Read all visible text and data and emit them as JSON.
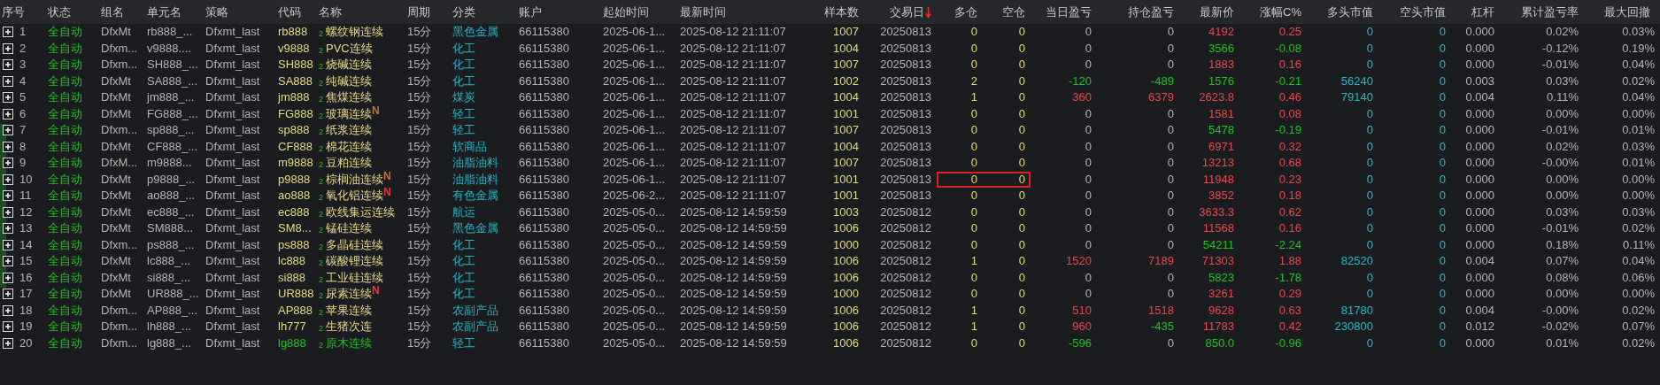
{
  "columns": [
    {
      "label": "序号",
      "sorted": false
    },
    {
      "label": "状态",
      "sorted": false
    },
    {
      "label": "组名",
      "sorted": false
    },
    {
      "label": "单元名",
      "sorted": false
    },
    {
      "label": "策略",
      "sorted": false
    },
    {
      "label": "代码",
      "sorted": false
    },
    {
      "label": "名称",
      "sorted": false
    },
    {
      "label": "周期",
      "sorted": false
    },
    {
      "label": "分类",
      "sorted": false
    },
    {
      "label": "账户",
      "sorted": false
    },
    {
      "label": "起始时间",
      "sorted": false
    },
    {
      "label": "最新时间",
      "sorted": false
    },
    {
      "label": "样本数",
      "sorted": false
    },
    {
      "label": "交易日",
      "sorted": true
    },
    {
      "label": "多仓",
      "sorted": false
    },
    {
      "label": "空仓",
      "sorted": false
    },
    {
      "label": "当日盈亏",
      "sorted": false
    },
    {
      "label": "持仓盈亏",
      "sorted": false
    },
    {
      "label": "最新价",
      "sorted": false
    },
    {
      "label": "涨幅C%",
      "sorted": false
    },
    {
      "label": "多头市值",
      "sorted": false
    },
    {
      "label": "空头市值",
      "sorted": false
    },
    {
      "label": "杠杆",
      "sorted": false
    },
    {
      "label": "累计盈亏率",
      "sorted": false
    },
    {
      "label": "最大回撤",
      "sorted": false
    }
  ],
  "rows": [
    {
      "expanded": false,
      "seq": "1",
      "status": "全自动",
      "group": "DfxMt",
      "unit": "rb888_...",
      "strategy": "Dfxmt_last",
      "code": "rb888",
      "highlighted": false,
      "tag": "2",
      "name": "螺纹钢连续",
      "period": "15分",
      "category": "黑色金属",
      "account": "66115380",
      "start": "2025-06-1...",
      "latest": "2025-08-12 21:11:07",
      "samples": "1007",
      "trade_day": "20250813",
      "long": "0",
      "short": "0",
      "boxed": false,
      "day_pnl": {
        "text": "0",
        "color": "#b4b4b4"
      },
      "pos_pnl": {
        "text": "0",
        "color": "#b4b4b4"
      },
      "price": {
        "text": "4192",
        "color": "#e5484d"
      },
      "change": {
        "text": "0.25",
        "color": "#e5484d"
      },
      "long_value": "0",
      "short_value": "0",
      "leverage": "0.000",
      "cum_rate": "0.02%",
      "max_dd": "0.03%"
    },
    {
      "expanded": false,
      "seq": "2",
      "status": "全自动",
      "group": "Dfxm...",
      "unit": "v9888....",
      "strategy": "Dfxmt_last",
      "code": "v9888",
      "highlighted": false,
      "tag": "2",
      "name": "PVC连续",
      "period": "15分",
      "category": "化工",
      "account": "66115380",
      "start": "2025-06-1...",
      "latest": "2025-08-12 21:11:07",
      "samples": "1004",
      "trade_day": "20250813",
      "long": "0",
      "short": "0",
      "boxed": false,
      "day_pnl": {
        "text": "0",
        "color": "#b4b4b4"
      },
      "pos_pnl": {
        "text": "0",
        "color": "#b4b4b4"
      },
      "price": {
        "text": "3566",
        "color": "#1fc21f"
      },
      "change": {
        "text": "-0.08",
        "color": "#1fc21f"
      },
      "long_value": "0",
      "short_value": "0",
      "leverage": "0.000",
      "cum_rate": "-0.12%",
      "max_dd": "0.19%"
    },
    {
      "expanded": false,
      "seq": "3",
      "status": "全自动",
      "group": "Dfxm...",
      "unit": "SH888_...",
      "strategy": "Dfxmt_last",
      "code": "SH888",
      "highlighted": false,
      "tag": "2",
      "name": "烧碱连续",
      "period": "15分",
      "category": "化工",
      "account": "66115380",
      "start": "2025-06-1...",
      "latest": "2025-08-12 21:11:07",
      "samples": "1007",
      "trade_day": "20250813",
      "long": "0",
      "short": "0",
      "boxed": false,
      "day_pnl": {
        "text": "0",
        "color": "#b4b4b4"
      },
      "pos_pnl": {
        "text": "0",
        "color": "#b4b4b4"
      },
      "price": {
        "text": "1883",
        "color": "#e5484d"
      },
      "change": {
        "text": "0.16",
        "color": "#e5484d"
      },
      "long_value": "0",
      "short_value": "0",
      "leverage": "0.000",
      "cum_rate": "-0.01%",
      "max_dd": "0.04%"
    },
    {
      "expanded": false,
      "seq": "4",
      "status": "全自动",
      "group": "DfxMt",
      "unit": "SA888_...",
      "strategy": "Dfxmt_last",
      "code": "SA888",
      "highlighted": false,
      "tag": "2",
      "name": "纯碱连续",
      "period": "15分",
      "category": "化工",
      "account": "66115380",
      "start": "2025-06-1...",
      "latest": "2025-08-12 21:11:07",
      "samples": "1002",
      "trade_day": "20250813",
      "long": "2",
      "short": "0",
      "boxed": false,
      "day_pnl": {
        "text": "-120",
        "color": "#1fc21f"
      },
      "pos_pnl": {
        "text": "-489",
        "color": "#1fc21f"
      },
      "price": {
        "text": "1576",
        "color": "#1fc21f"
      },
      "change": {
        "text": "-0.21",
        "color": "#1fc21f"
      },
      "long_value": "56240",
      "short_value": "0",
      "leverage": "0.003",
      "cum_rate": "0.03%",
      "max_dd": "0.02%"
    },
    {
      "expanded": false,
      "seq": "5",
      "status": "全自动",
      "group": "DfxMt",
      "unit": "jm888_...",
      "strategy": "Dfxmt_last",
      "code": "jm888",
      "highlighted": false,
      "tag": "2",
      "name": "焦煤连续",
      "period": "15分",
      "category": "煤炭",
      "account": "66115380",
      "start": "2025-06-1...",
      "latest": "2025-08-12 21:11:07",
      "samples": "1004",
      "trade_day": "20250813",
      "long": "1",
      "short": "0",
      "boxed": false,
      "day_pnl": {
        "text": "360",
        "color": "#e5484d"
      },
      "pos_pnl": {
        "text": "6379",
        "color": "#e5484d"
      },
      "price": {
        "text": "2623.8",
        "color": "#e5484d"
      },
      "change": {
        "text": "0.46",
        "color": "#e5484d"
      },
      "long_value": "79140",
      "short_value": "0",
      "leverage": "0.004",
      "cum_rate": "0.11%",
      "max_dd": "0.04%"
    },
    {
      "expanded": false,
      "seq": "6",
      "status": "全自动",
      "group": "DfxMt",
      "unit": "FG888_...",
      "strategy": "Dfxmt_last",
      "code": "FG888",
      "highlighted": false,
      "tag": "2",
      "name": "玻璃连续",
      "flag": {
        "text": "N",
        "color": "#c8703c"
      },
      "period": "15分",
      "category": "轻工",
      "account": "66115380",
      "start": "2025-06-1...",
      "latest": "2025-08-12 21:11:07",
      "samples": "1001",
      "trade_day": "20250813",
      "long": "0",
      "short": "0",
      "boxed": false,
      "day_pnl": {
        "text": "0",
        "color": "#b4b4b4"
      },
      "pos_pnl": {
        "text": "0",
        "color": "#b4b4b4"
      },
      "price": {
        "text": "1581",
        "color": "#e5484d"
      },
      "change": {
        "text": "0.08",
        "color": "#e5484d"
      },
      "long_value": "0",
      "short_value": "0",
      "leverage": "0.000",
      "cum_rate": "0.00%",
      "max_dd": "0.00%"
    },
    {
      "expanded": false,
      "seq": "7",
      "status": "全自动",
      "group": "Dfxm...",
      "unit": "sp888_...",
      "strategy": "Dfxmt_last",
      "code": "sp888",
      "highlighted": false,
      "tag": "2",
      "name": "纸浆连续",
      "period": "15分",
      "category": "轻工",
      "account": "66115380",
      "start": "2025-06-1...",
      "latest": "2025-08-12 21:11:07",
      "samples": "1007",
      "trade_day": "20250813",
      "long": "0",
      "short": "0",
      "boxed": false,
      "day_pnl": {
        "text": "0",
        "color": "#b4b4b4"
      },
      "pos_pnl": {
        "text": "0",
        "color": "#b4b4b4"
      },
      "price": {
        "text": "5478",
        "color": "#1fc21f"
      },
      "change": {
        "text": "-0.19",
        "color": "#1fc21f"
      },
      "long_value": "0",
      "short_value": "0",
      "leverage": "0.000",
      "cum_rate": "-0.01%",
      "max_dd": "0.01%"
    },
    {
      "expanded": false,
      "seq": "8",
      "status": "全自动",
      "group": "DfxMt",
      "unit": "CF888_...",
      "strategy": "Dfxmt_last",
      "code": "CF888",
      "highlighted": false,
      "tag": "2",
      "name": "棉花连续",
      "period": "15分",
      "category": "软商品",
      "account": "66115380",
      "start": "2025-06-1...",
      "latest": "2025-08-12 21:11:07",
      "samples": "1004",
      "trade_day": "20250813",
      "long": "0",
      "short": "0",
      "boxed": false,
      "day_pnl": {
        "text": "0",
        "color": "#b4b4b4"
      },
      "pos_pnl": {
        "text": "0",
        "color": "#b4b4b4"
      },
      "price": {
        "text": "6971",
        "color": "#e5484d"
      },
      "change": {
        "text": "0.32",
        "color": "#e5484d"
      },
      "long_value": "0",
      "short_value": "0",
      "leverage": "0.000",
      "cum_rate": "0.02%",
      "max_dd": "0.03%"
    },
    {
      "expanded": false,
      "seq": "9",
      "status": "全自动",
      "group": "DfxM...",
      "unit": "m9888...",
      "strategy": "Dfxmt_last",
      "code": "m9888",
      "highlighted": false,
      "tag": "2",
      "name": "豆粕连续",
      "period": "15分",
      "category": "油脂油料",
      "account": "66115380",
      "start": "2025-06-1...",
      "latest": "2025-08-12 21:11:07",
      "samples": "1007",
      "trade_day": "20250813",
      "long": "0",
      "short": "0",
      "boxed": false,
      "day_pnl": {
        "text": "0",
        "color": "#b4b4b4"
      },
      "pos_pnl": {
        "text": "0",
        "color": "#b4b4b4"
      },
      "price": {
        "text": "13213",
        "color": "#e5484d"
      },
      "change": {
        "text": "0.68",
        "color": "#e5484d"
      },
      "long_value": "0",
      "short_value": "0",
      "leverage": "0.000",
      "cum_rate": "-0.00%",
      "max_dd": "0.01%"
    },
    {
      "expanded": false,
      "seq": "10",
      "status": "全自动",
      "group": "DfxMt",
      "unit": "p9888_...",
      "strategy": "Dfxmt_last",
      "code": "p9888",
      "highlighted": false,
      "tag": "2",
      "name": "棕榈油连续",
      "flag": {
        "text": "N",
        "color": "#c8703c"
      },
      "period": "15分",
      "category": "油脂油料",
      "account": "66115380",
      "start": "2025-06-1...",
      "latest": "2025-08-12 21:11:07",
      "samples": "1001",
      "trade_day": "20250813",
      "long": "0",
      "short": "0",
      "boxed": true,
      "day_pnl": {
        "text": "0",
        "color": "#b4b4b4"
      },
      "pos_pnl": {
        "text": "0",
        "color": "#b4b4b4"
      },
      "price": {
        "text": "11948",
        "color": "#e5484d"
      },
      "change": {
        "text": "0.23",
        "color": "#e5484d"
      },
      "long_value": "0",
      "short_value": "0",
      "leverage": "0.000",
      "cum_rate": "0.00%",
      "max_dd": "0.00%"
    },
    {
      "expanded": false,
      "seq": "11",
      "status": "全自动",
      "group": "DfxMt",
      "unit": "ao888_...",
      "strategy": "Dfxmt_last",
      "code": "ao888",
      "highlighted": false,
      "tag": "2",
      "name": "氧化铝连续",
      "flag": {
        "text": "N",
        "color": "#e83a3a"
      },
      "period": "15分",
      "category": "有色金属",
      "account": "66115380",
      "start": "2025-06-2...",
      "latest": "2025-08-12 21:11:07",
      "samples": "1001",
      "trade_day": "20250813",
      "long": "0",
      "short": "0",
      "boxed": false,
      "day_pnl": {
        "text": "0",
        "color": "#b4b4b4"
      },
      "pos_pnl": {
        "text": "0",
        "color": "#b4b4b4"
      },
      "price": {
        "text": "3852",
        "color": "#e5484d"
      },
      "change": {
        "text": "0.18",
        "color": "#e5484d"
      },
      "long_value": "0",
      "short_value": "0",
      "leverage": "0.000",
      "cum_rate": "0.00%",
      "max_dd": "0.00%"
    },
    {
      "expanded": false,
      "seq": "12",
      "status": "全自动",
      "group": "DfxMt",
      "unit": "ec888_...",
      "strategy": "Dfxmt_last",
      "code": "ec888",
      "highlighted": false,
      "tag": "2",
      "name": "欧线集运连续",
      "period": "15分",
      "category": "航运",
      "account": "66115380",
      "start": "2025-05-0...",
      "latest": "2025-08-12 14:59:59",
      "samples": "1003",
      "trade_day": "20250812",
      "long": "0",
      "short": "0",
      "boxed": false,
      "day_pnl": {
        "text": "0",
        "color": "#b4b4b4"
      },
      "pos_pnl": {
        "text": "0",
        "color": "#b4b4b4"
      },
      "price": {
        "text": "3633.3",
        "color": "#e5484d"
      },
      "change": {
        "text": "0.62",
        "color": "#e5484d"
      },
      "long_value": "0",
      "short_value": "0",
      "leverage": "0.000",
      "cum_rate": "0.03%",
      "max_dd": "0.03%"
    },
    {
      "expanded": false,
      "seq": "13",
      "status": "全自动",
      "group": "DfxMt",
      "unit": "SM888...",
      "strategy": "Dfxmt_last",
      "code": "SM8...",
      "highlighted": false,
      "tag": "2",
      "name": "锰硅连续",
      "period": "15分",
      "category": "黑色金属",
      "account": "66115380",
      "start": "2025-05-0...",
      "latest": "2025-08-12 14:59:59",
      "samples": "1006",
      "trade_day": "20250812",
      "long": "0",
      "short": "0",
      "boxed": false,
      "day_pnl": {
        "text": "0",
        "color": "#b4b4b4"
      },
      "pos_pnl": {
        "text": "0",
        "color": "#b4b4b4"
      },
      "price": {
        "text": "11568",
        "color": "#e5484d"
      },
      "change": {
        "text": "0.16",
        "color": "#e5484d"
      },
      "long_value": "0",
      "short_value": "0",
      "leverage": "0.000",
      "cum_rate": "-0.01%",
      "max_dd": "0.02%"
    },
    {
      "expanded": false,
      "seq": "14",
      "status": "全自动",
      "group": "Dfxm...",
      "unit": "ps888_...",
      "strategy": "Dfxmt_last",
      "code": "ps888",
      "highlighted": false,
      "tag": "2",
      "name": "多晶硅连续",
      "period": "15分",
      "category": "化工",
      "account": "66115380",
      "start": "2025-05-0...",
      "latest": "2025-08-12 14:59:59",
      "samples": "1000",
      "trade_day": "20250812",
      "long": "0",
      "short": "0",
      "boxed": false,
      "day_pnl": {
        "text": "0",
        "color": "#b4b4b4"
      },
      "pos_pnl": {
        "text": "0",
        "color": "#b4b4b4"
      },
      "price": {
        "text": "54211",
        "color": "#1fc21f"
      },
      "change": {
        "text": "-2.24",
        "color": "#1fc21f"
      },
      "long_value": "0",
      "short_value": "0",
      "leverage": "0.000",
      "cum_rate": "0.18%",
      "max_dd": "0.11%"
    },
    {
      "expanded": false,
      "seq": "15",
      "status": "全自动",
      "group": "DfxMt",
      "unit": "lc888_...",
      "strategy": "Dfxmt_last",
      "code": "lc888",
      "highlighted": false,
      "tag": "2",
      "name": "碳酸锂连续",
      "period": "15分",
      "category": "化工",
      "account": "66115380",
      "start": "2025-05-0...",
      "latest": "2025-08-12 14:59:59",
      "samples": "1006",
      "trade_day": "20250812",
      "long": "1",
      "short": "0",
      "boxed": false,
      "day_pnl": {
        "text": "1520",
        "color": "#e5484d"
      },
      "pos_pnl": {
        "text": "7189",
        "color": "#e5484d"
      },
      "price": {
        "text": "71303",
        "color": "#e5484d"
      },
      "change": {
        "text": "1.88",
        "color": "#e5484d"
      },
      "long_value": "82520",
      "short_value": "0",
      "leverage": "0.004",
      "cum_rate": "0.07%",
      "max_dd": "0.04%"
    },
    {
      "expanded": false,
      "seq": "16",
      "status": "全自动",
      "group": "DfxMt",
      "unit": "si888_...",
      "strategy": "Dfxmt_last",
      "code": "si888",
      "highlighted": false,
      "tag": "2",
      "name": "工业硅连续",
      "period": "15分",
      "category": "化工",
      "account": "66115380",
      "start": "2025-05-0...",
      "latest": "2025-08-12 14:59:59",
      "samples": "1006",
      "trade_day": "20250812",
      "long": "0",
      "short": "0",
      "boxed": false,
      "day_pnl": {
        "text": "0",
        "color": "#b4b4b4"
      },
      "pos_pnl": {
        "text": "0",
        "color": "#b4b4b4"
      },
      "price": {
        "text": "5823",
        "color": "#1fc21f"
      },
      "change": {
        "text": "-1.78",
        "color": "#1fc21f"
      },
      "long_value": "0",
      "short_value": "0",
      "leverage": "0.000",
      "cum_rate": "0.08%",
      "max_dd": "0.06%"
    },
    {
      "expanded": false,
      "seq": "17",
      "status": "全自动",
      "group": "DfxMt",
      "unit": "UR888_...",
      "strategy": "Dfxmt_last",
      "code": "UR888",
      "highlighted": false,
      "tag": "2",
      "name": "尿素连续",
      "flag": {
        "text": "N",
        "color": "#e83a3a"
      },
      "period": "15分",
      "category": "化工",
      "account": "66115380",
      "start": "2025-05-0...",
      "latest": "2025-08-12 14:59:59",
      "samples": "1000",
      "trade_day": "20250812",
      "long": "0",
      "short": "0",
      "boxed": false,
      "day_pnl": {
        "text": "0",
        "color": "#b4b4b4"
      },
      "pos_pnl": {
        "text": "0",
        "color": "#b4b4b4"
      },
      "price": {
        "text": "3261",
        "color": "#e5484d"
      },
      "change": {
        "text": "0.29",
        "color": "#e5484d"
      },
      "long_value": "0",
      "short_value": "0",
      "leverage": "0.000",
      "cum_rate": "0.00%",
      "max_dd": "0.00%"
    },
    {
      "expanded": false,
      "seq": "18",
      "status": "全自动",
      "group": "Dfxm...",
      "unit": "AP888_...",
      "strategy": "Dfxmt_last",
      "code": "AP888",
      "highlighted": false,
      "tag": "2",
      "name": "苹果连续",
      "period": "15分",
      "category": "农副产品",
      "account": "66115380",
      "start": "2025-05-0...",
      "latest": "2025-08-12 14:59:59",
      "samples": "1006",
      "trade_day": "20250812",
      "long": "1",
      "short": "0",
      "boxed": false,
      "day_pnl": {
        "text": "510",
        "color": "#e5484d"
      },
      "pos_pnl": {
        "text": "1518",
        "color": "#e5484d"
      },
      "price": {
        "text": "9628",
        "color": "#e5484d"
      },
      "change": {
        "text": "0.63",
        "color": "#e5484d"
      },
      "long_value": "81780",
      "short_value": "0",
      "leverage": "0.004",
      "cum_rate": "-0.00%",
      "max_dd": "0.02%"
    },
    {
      "expanded": false,
      "seq": "19",
      "status": "全自动",
      "group": "Dfxm...",
      "unit": "lh888_...",
      "strategy": "Dfxmt_last",
      "code": "lh777",
      "highlighted": false,
      "tag": "2",
      "name": "生猪次连",
      "period": "15分",
      "category": "农副产品",
      "account": "66115380",
      "start": "2025-05-0...",
      "latest": "2025-08-12 14:59:59",
      "samples": "1006",
      "trade_day": "20250812",
      "long": "1",
      "short": "0",
      "boxed": false,
      "day_pnl": {
        "text": "960",
        "color": "#e5484d"
      },
      "pos_pnl": {
        "text": "-435",
        "color": "#1fc21f"
      },
      "price": {
        "text": "11783",
        "color": "#e5484d"
      },
      "change": {
        "text": "0.42",
        "color": "#e5484d"
      },
      "long_value": "230800",
      "short_value": "0",
      "leverage": "0.012",
      "cum_rate": "-0.02%",
      "max_dd": "0.07%"
    },
    {
      "expanded": false,
      "seq": "20",
      "status": "全自动",
      "group": "Dfxm...",
      "unit": "lg888_...",
      "strategy": "Dfxmt_last",
      "code": "lg888",
      "highlighted": true,
      "tag": "2",
      "name": "原木连续",
      "period": "15分",
      "category": "轻工",
      "account": "66115380",
      "start": "2025-05-0...",
      "latest": "2025-08-12 14:59:59",
      "samples": "1006",
      "trade_day": "20250812",
      "long": "0",
      "short": "0",
      "boxed": false,
      "day_pnl": {
        "text": "-596",
        "color": "#1fc21f"
      },
      "pos_pnl": {
        "text": "0",
        "color": "#b4b4b4"
      },
      "price": {
        "text": "850.0",
        "color": "#1fc21f"
      },
      "change": {
        "text": "-0.96",
        "color": "#1fc21f"
      },
      "long_value": "0",
      "short_value": "0",
      "leverage": "0.000",
      "cum_rate": "0.01%",
      "max_dd": "0.02%"
    }
  ]
}
